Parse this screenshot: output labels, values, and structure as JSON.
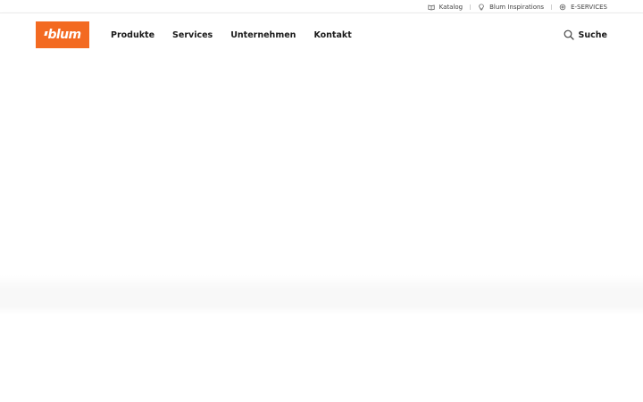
{
  "utility": {
    "links": [
      {
        "label": "Katalog",
        "icon": "book-icon"
      },
      {
        "label": "Blum Inspirations",
        "icon": "lightbulb-icon"
      },
      {
        "label": "E-SERVICES",
        "icon": "settings-icon"
      }
    ]
  },
  "header": {
    "logo_text": "blum",
    "brand_color": "#f36a21",
    "nav": [
      {
        "label": "Produkte"
      },
      {
        "label": "Services"
      },
      {
        "label": "Unternehmen"
      },
      {
        "label": "Kontakt"
      }
    ],
    "search_label": "Suche"
  }
}
